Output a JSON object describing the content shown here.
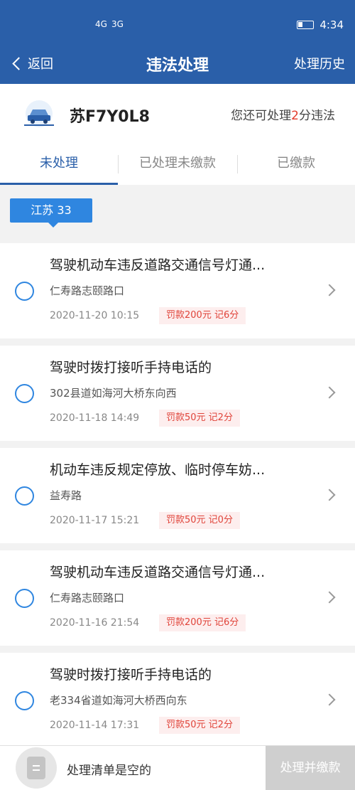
{
  "status": {
    "network1": "4G",
    "network2": "3G",
    "time": "4:34"
  },
  "nav": {
    "back_label": "返回",
    "title": "违法处理",
    "history_label": "处理历史"
  },
  "plate": {
    "number": "苏F7Y0L8",
    "remain_prefix": "您还可处理",
    "remain_points": "2",
    "remain_suffix": "分违法"
  },
  "tabs": [
    {
      "label": "未处理"
    },
    {
      "label": "已处理未缴款"
    },
    {
      "label": "已缴款"
    }
  ],
  "region": {
    "label": "江苏 33"
  },
  "violations": [
    {
      "title": "驾驶机动车违反道路交通信号灯通...",
      "place": "仁寿路志颐路口",
      "time": "2020-11-20 10:15",
      "fine": "罚款200元 记6分"
    },
    {
      "title": "驾驶时拨打接听手持电话的",
      "place": "302县道如海河大桥东向西",
      "time": "2020-11-18 14:49",
      "fine": "罚款50元 记2分"
    },
    {
      "title": "机动车违反规定停放、临时停车妨...",
      "place": "益寿路",
      "time": "2020-11-17 15:21",
      "fine": "罚款50元 记0分"
    },
    {
      "title": "驾驶机动车违反道路交通信号灯通...",
      "place": "仁寿路志颐路口",
      "time": "2020-11-16 21:54",
      "fine": "罚款200元 记6分"
    },
    {
      "title": "驾驶时拨打接听手持电话的",
      "place": "老334省道如海河大桥西向东",
      "time": "2020-11-14 17:31",
      "fine": "罚款50元 记2分"
    }
  ],
  "bottom": {
    "empty_text": "处理清单是空的",
    "submit_label": "处理并缴款",
    "list_icon_glyph": "☰"
  },
  "colors": {
    "primary": "#2a5fa9",
    "accent": "#2f86e0",
    "alert": "#e23a2a"
  }
}
